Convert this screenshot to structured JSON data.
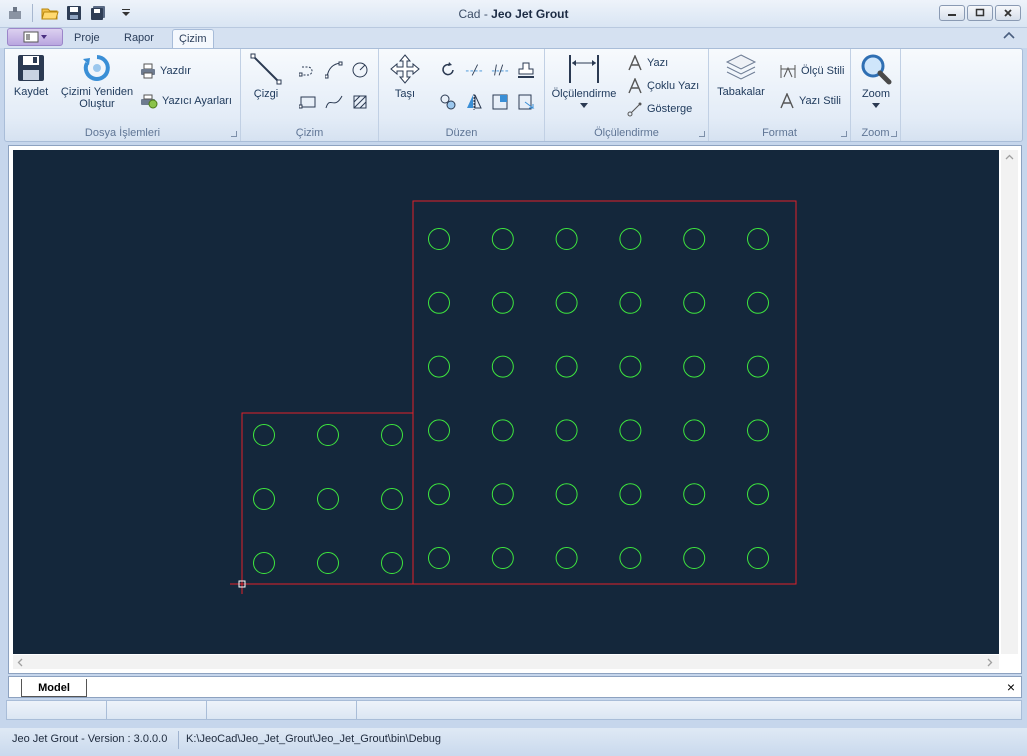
{
  "window": {
    "app_prefix": "Cad",
    "separator": " - ",
    "title": "Jeo Jet Grout"
  },
  "quick_access": [
    "app-icon",
    "open-folder-icon",
    "save-icon",
    "save-all-icon",
    "customize-dropdown-icon"
  ],
  "tabs": [
    {
      "label": "Proje",
      "active": false
    },
    {
      "label": "Rapor",
      "active": false
    },
    {
      "label": "Çizim",
      "active": true
    }
  ],
  "ribbon": {
    "dosya": {
      "label": "Dosya İşlemleri",
      "kaydet": "Kaydet",
      "cizimi_yeniden_1": "Çizimi Yeniden",
      "cizimi_yeniden_2": "Oluştur",
      "yazdir": "Yazdır",
      "yazici_ayarlari": "Yazıcı Ayarları"
    },
    "cizim": {
      "label": "Çizim",
      "cizgi": "Çizgi"
    },
    "duzen": {
      "label": "Düzen",
      "tasi": "Taşı"
    },
    "olcu": {
      "label": "Ölçülendirme",
      "olculendirme": "Ölçülendirme",
      "yazi": "Yazı",
      "coklu_yazi": "Çoklu Yazı",
      "gosterge": "Gösterge"
    },
    "format": {
      "label": "Format",
      "tabakalar": "Tabakalar",
      "olcu_stili": "Ölçü Stili",
      "yazi_stili": "Yazı Stili"
    },
    "zoom": {
      "label": "Zoom",
      "zoom": "Zoom"
    }
  },
  "drawing": {
    "background": "#14273b",
    "boundary_color": "#e0202a",
    "circle_color": "#3ee63e",
    "large_grid": {
      "rows": 6,
      "cols": 6
    },
    "small_grid": {
      "rows": 3,
      "cols": 3
    }
  },
  "model_tab": {
    "label": "Model",
    "close": "×"
  },
  "statusbar": {
    "version": "Jeo Jet Grout - Version : 3.0.0.0",
    "path": "K:\\JeoCad\\Jeo_Jet_Grout\\Jeo_Jet_Grout\\bin\\Debug"
  }
}
